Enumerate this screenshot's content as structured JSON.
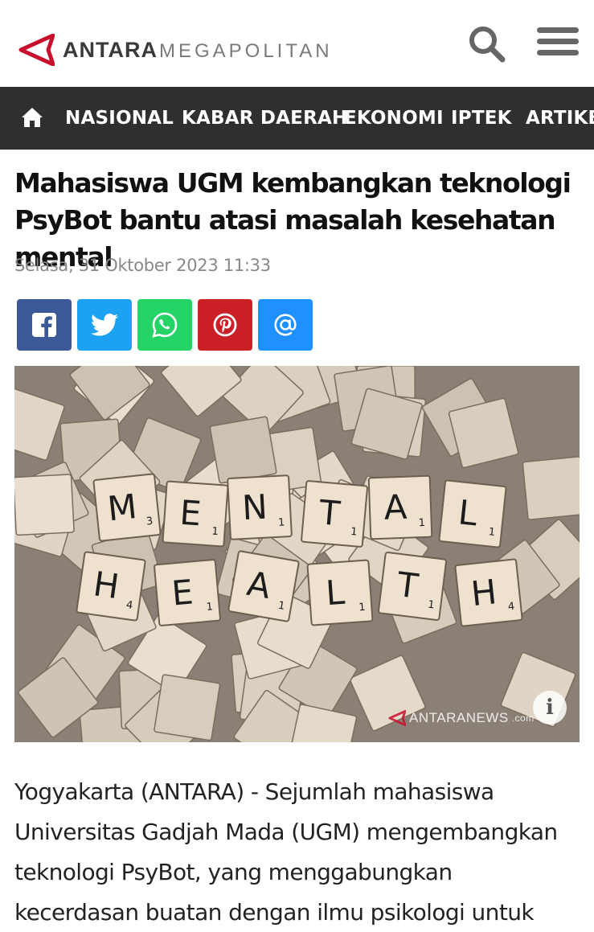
{
  "header": {
    "logo_primary": "ANTARA",
    "logo_secondary": "MEGAPOLITAN",
    "search_icon": "search-icon",
    "menu_icon": "hamburger-menu-icon"
  },
  "nav": {
    "home_icon": "home-icon",
    "items": [
      {
        "label": "NASIONAL"
      },
      {
        "label": "KABAR DAERAH"
      },
      {
        "label": "EKONOMI"
      },
      {
        "label": "IPTEK"
      },
      {
        "label": "ARTIKEL"
      }
    ]
  },
  "article": {
    "title": "Mahasiswa UGM kembangkan teknologi PsyBot bantu atasi masalah kesehatan mental",
    "date": "Selasa, 31 Oktober 2023 11:33",
    "share": [
      {
        "name": "facebook",
        "icon": "facebook-icon",
        "color": "#3b5998"
      },
      {
        "name": "twitter",
        "icon": "twitter-icon",
        "color": "#1da1f2"
      },
      {
        "name": "whatsapp",
        "icon": "whatsapp-icon",
        "color": "#25d366"
      },
      {
        "name": "pinterest",
        "icon": "pinterest-icon",
        "color": "#cb2027"
      },
      {
        "name": "email",
        "icon": "at-sign-icon",
        "color": "#1e90ff"
      }
    ],
    "image": {
      "tiles_row1": [
        "M",
        "E",
        "N",
        "T",
        "A",
        "L"
      ],
      "tiles_row1_points": [
        "3",
        "1",
        "1",
        "1",
        "1",
        "1"
      ],
      "tiles_row2": [
        "H",
        "E",
        "A",
        "L",
        "T",
        "H"
      ],
      "tiles_row2_points": [
        "4",
        "1",
        "1",
        "1",
        "1",
        "4"
      ],
      "watermark_main": "ANTARANEWS",
      "watermark_sub": ".com",
      "info_icon": "info-icon"
    },
    "body": "Yogyakarta (ANTARA) - Sejumlah mahasiswa Universitas Gadjah Mada (UGM) mengembangkan teknologi PsyBot, yang menggabungkan kecerdasan buatan dengan ilmu psikologi untuk membantu"
  },
  "colors": {
    "brand_red": "#c8102e",
    "nav_bg": "#2f2f2f",
    "date_gray": "#888888"
  }
}
